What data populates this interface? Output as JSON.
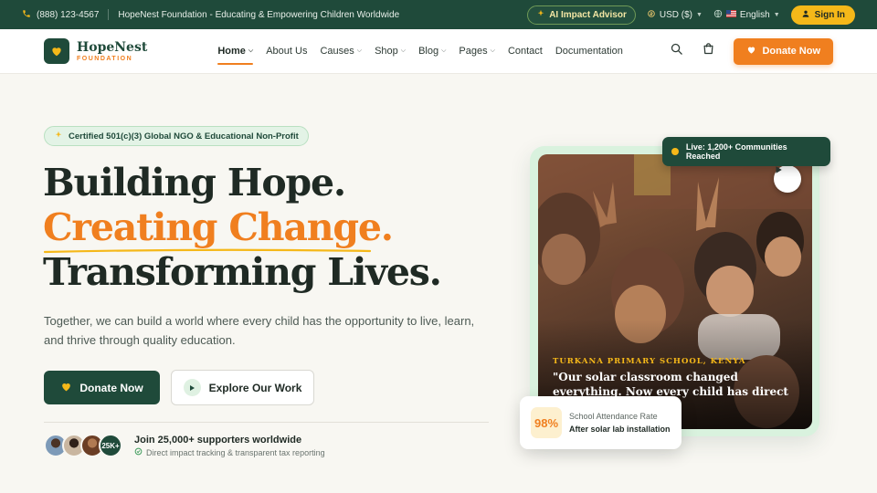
{
  "topbar": {
    "phone": "(888) 123-4567",
    "tagline": "HopeNest Foundation - Educating & Empowering Children Worldwide",
    "ai_advisor": "AI Impact Advisor",
    "currency": "USD ($)",
    "language": "English",
    "signin": "Sign In"
  },
  "brand": {
    "name": "HopeNest",
    "sub": "FOUNDATION"
  },
  "nav": {
    "items": [
      {
        "label": "Home",
        "dropdown": true,
        "active": true
      },
      {
        "label": "About Us",
        "dropdown": false
      },
      {
        "label": "Causes",
        "dropdown": true
      },
      {
        "label": "Shop",
        "dropdown": true
      },
      {
        "label": "Blog",
        "dropdown": true
      },
      {
        "label": "Pages",
        "dropdown": true
      },
      {
        "label": "Contact",
        "dropdown": false
      },
      {
        "label": "Documentation",
        "dropdown": false
      }
    ],
    "donate": "Donate Now"
  },
  "hero": {
    "badge": "Certified 501(c)(3) Global NGO & Educational Non-Profit",
    "line1": "Building Hope.",
    "line2": "Creating Change.",
    "line3": "Transforming Lives.",
    "lead": "Together, we can build a world where every child has the opportunity to live, learn, and thrive through quality education.",
    "cta_primary": "Donate Now",
    "cta_secondary": "Explore Our Work",
    "supporters_count": "25K+",
    "supporters_title": "Join 25,000+ supporters worldwide",
    "supporters_sub": "Direct impact tracking & transparent tax reporting"
  },
  "media": {
    "live": "Live: 1,200+ Communities Reached",
    "location": "TURKANA PRIMARY SCHOOL, KENYA",
    "quote": "\"Our solar classroom changed everything. Now every child has direct access.\"",
    "stat_value": "98%",
    "stat_label": "School Attendance Rate",
    "stat_sub": "After solar lab installation"
  },
  "colors": {
    "brand_green": "#1f4a3a",
    "accent_orange": "#f07f1f",
    "accent_yellow": "#f5b819",
    "background": "#f8f7f2"
  },
  "icons": {
    "phone": "phone-icon",
    "ai": "sparkle-icon",
    "currency": "coin-icon",
    "language": "globe-icon",
    "signin": "user-icon",
    "search": "search-icon",
    "cart": "cart-icon",
    "heart": "heart-icon",
    "play": "play-icon",
    "check": "check-circle-icon"
  }
}
